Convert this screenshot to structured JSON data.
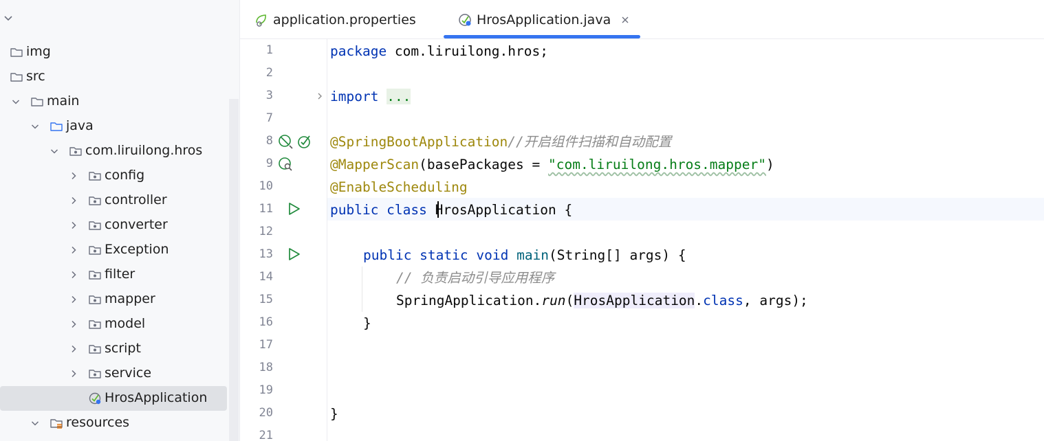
{
  "tree": {
    "items": [
      {
        "label": "img",
        "icon": "folder-icon",
        "expanded": null
      },
      {
        "label": "src",
        "icon": "folder-icon",
        "expanded": true
      },
      {
        "label": "main",
        "icon": "folder-icon",
        "expanded": true
      },
      {
        "label": "java",
        "icon": "source-folder-icon",
        "expanded": true
      },
      {
        "label": "com.liruilong.hros",
        "icon": "package-icon",
        "expanded": true
      },
      {
        "label": "config",
        "icon": "package-icon",
        "expanded": false
      },
      {
        "label": "controller",
        "icon": "package-icon",
        "expanded": false
      },
      {
        "label": "converter",
        "icon": "package-icon",
        "expanded": false
      },
      {
        "label": "Exception",
        "icon": "package-icon",
        "expanded": false
      },
      {
        "label": "filter",
        "icon": "package-icon",
        "expanded": false
      },
      {
        "label": "mapper",
        "icon": "package-icon",
        "expanded": false
      },
      {
        "label": "model",
        "icon": "package-icon",
        "expanded": false
      },
      {
        "label": "script",
        "icon": "package-icon",
        "expanded": false
      },
      {
        "label": "service",
        "icon": "package-icon",
        "expanded": false
      },
      {
        "label": "HrosApplication",
        "icon": "spring-boot-class-icon",
        "expanded": null
      },
      {
        "label": "resources",
        "icon": "resources-folder-icon",
        "expanded": true
      }
    ]
  },
  "tabs": [
    {
      "label": "application.properties",
      "icon": "spring-properties-icon",
      "active": false
    },
    {
      "label": "HrosApplication.java",
      "icon": "spring-boot-class-icon",
      "active": true
    }
  ],
  "editor": {
    "line_numbers": [
      "1",
      "2",
      "3",
      "7",
      "8",
      "9",
      "10",
      "11",
      "12",
      "13",
      "14",
      "15",
      "16",
      "17",
      "18",
      "19",
      "20",
      "21"
    ],
    "code": {
      "l1_kw": "package",
      "l1_rest": " com.liruilong.hros;",
      "l3_kw": "import",
      "l3_fold": "...",
      "l8_ann": "@SpringBootApplication",
      "l8_cmt": "//开启组件扫描和自动配置",
      "l9_ann": "@MapperScan",
      "l9_open": "(basePackages = ",
      "l9_str": "\"com.liruilong.hros.mapper\"",
      "l9_close": ")",
      "l10_ann": "@EnableScheduling",
      "l11_kw": "public class",
      "l11_name": "HrosApplication",
      "l11_brace": " {",
      "l13_kw": "public static void",
      "l13_fn": "main",
      "l13_rest": "(String[] args) {",
      "l14_cmt": "// 负责启动引导应用程序",
      "l15_obj": "SpringApplication.",
      "l15_fn": "run",
      "l15_paren": "(",
      "l15_ref": "HrosApplication",
      "l15_dot": ".",
      "l15_kw": "class",
      "l15_rest": ", args);",
      "l16": "}",
      "l20": "}"
    }
  },
  "colors": {
    "keyword": "#0033b3",
    "annotation": "#9e880d",
    "string": "#067d17",
    "comment": "#8c8c8c",
    "accent": "#3574f0",
    "run_green": "#208a3c"
  }
}
